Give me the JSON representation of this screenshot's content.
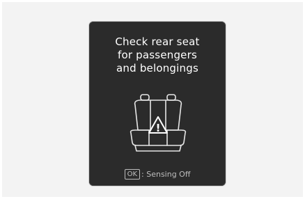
{
  "display": {
    "message_lines": [
      "Check rear seat",
      "for passengers",
      "and belongings"
    ],
    "graphic_icon": "rear-seat-warning-icon",
    "warning_symbol": "!",
    "ok_key_label": "OK",
    "ok_action_text": ": Sensing Off"
  },
  "colors": {
    "panel_background": "#2b2b2b",
    "text": "#ffffff",
    "secondary_text": "#bdbdbd"
  }
}
